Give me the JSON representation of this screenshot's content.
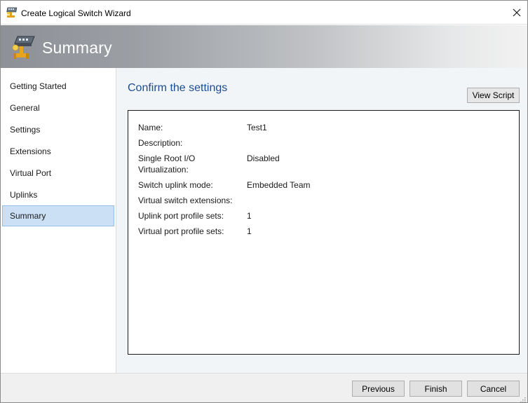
{
  "window": {
    "title": "Create Logical Switch Wizard",
    "close_icon": "close-icon"
  },
  "banner": {
    "title": "Summary",
    "icon": "network-switch-icon"
  },
  "sidebar": {
    "items": [
      {
        "label": "Getting Started",
        "active": false
      },
      {
        "label": "General",
        "active": false
      },
      {
        "label": "Settings",
        "active": false
      },
      {
        "label": "Extensions",
        "active": false
      },
      {
        "label": "Virtual Port",
        "active": false
      },
      {
        "label": "Uplinks",
        "active": false
      },
      {
        "label": "Summary",
        "active": true
      }
    ]
  },
  "main": {
    "heading": "Confirm the settings",
    "view_script_label": "View Script",
    "settings": [
      {
        "label": "Name:",
        "value": "Test1"
      },
      {
        "label": "Description:",
        "value": ""
      },
      {
        "label": "Single Root I/O Virtualization:",
        "value": "Disabled"
      },
      {
        "label": "Switch uplink mode:",
        "value": "Embedded Team"
      },
      {
        "label": "Virtual switch extensions:",
        "value": ""
      },
      {
        "label": "Uplink port profile sets:",
        "value": "1"
      },
      {
        "label": "Virtual port profile sets:",
        "value": "1"
      }
    ]
  },
  "footer": {
    "previous_label": "Previous",
    "finish_label": "Finish",
    "cancel_label": "Cancel"
  },
  "colors": {
    "heading": "#1c4d8f",
    "active_nav_bg": "#cce0f5",
    "active_nav_border": "#97bde3",
    "content_bg": "#f2f5f8"
  }
}
